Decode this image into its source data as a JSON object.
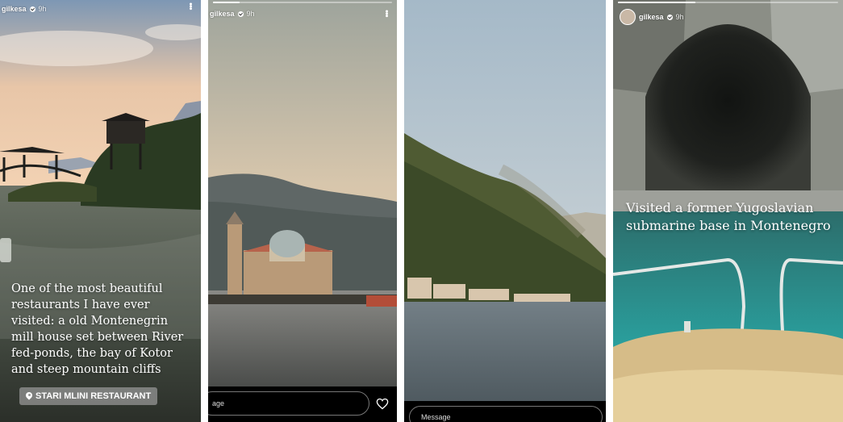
{
  "stories": [
    {
      "username": "gilkesa",
      "time": "9h",
      "menu_icon": "more-vertical-icon",
      "caption": "One of the most beautiful restaurants I have ever visited: a old Montenegrin mill house set between River fed-ponds, the bay of Kotor and steep mountain cliffs",
      "location_label": "STARI MLINI RESTAURANT",
      "location_icon": "location-pin-icon"
    },
    {
      "username": "gilkesa",
      "time": "9h",
      "menu_icon": "more-vertical-icon",
      "message_placeholder": "age",
      "like_icon": "heart-icon",
      "progress": 0.15
    },
    {
      "message_placeholder": "Message"
    },
    {
      "username": "gilkesa",
      "time": "9h",
      "caption": "Visited a former Yugoslavian submarine base in Montenegro",
      "progress": 0.35
    }
  ],
  "colors": {
    "message_bar": "#000000",
    "text": "#ffffff"
  }
}
